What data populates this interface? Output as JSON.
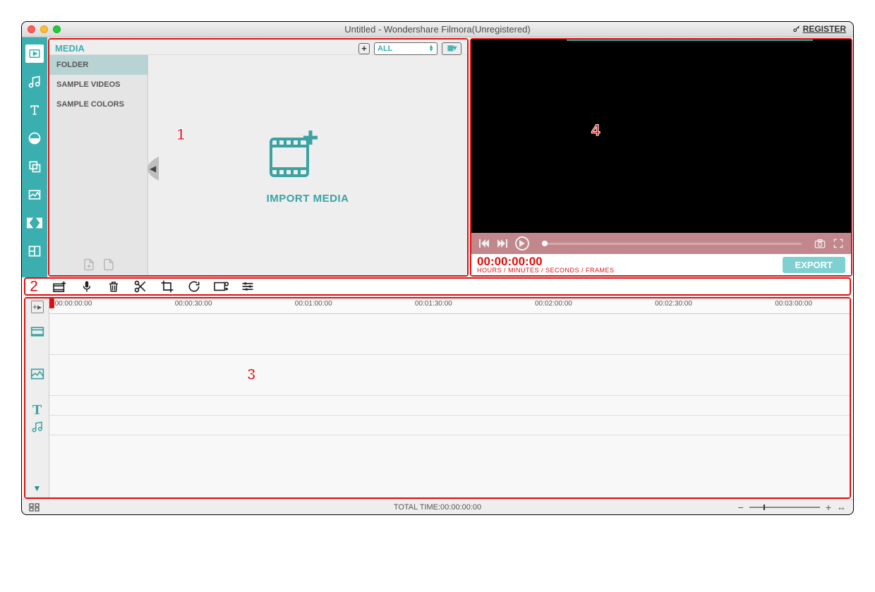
{
  "window": {
    "title": "Untitled - Wondershare Filmora(Unregistered)",
    "register_label": "REGISTER"
  },
  "media": {
    "header_label": "MEDIA",
    "filter_value": "ALL",
    "folders": [
      "FOLDER",
      "SAMPLE VIDEOS",
      "SAMPLE COLORS"
    ],
    "import_label": "IMPORT MEDIA"
  },
  "preview": {
    "timecode": "00:00:00:00",
    "timecode_label": "HOURS / MINUTES / SECONDS / FRAMES",
    "export_label": "EXPORT"
  },
  "timeline": {
    "ruler_labels": [
      "00:00:00:00",
      "00:00:30:00",
      "00:01:00:00",
      "00:01:30:00",
      "00:02:00:00",
      "00:02:30:00",
      "00:03:00:00"
    ]
  },
  "bottombar": {
    "total_time_label": "TOTAL TIME:00:00:00:00",
    "zoom_minus": "−",
    "zoom_plus": "+"
  },
  "annotations": {
    "one": "1",
    "two": "2",
    "three": "3",
    "four": "4"
  }
}
